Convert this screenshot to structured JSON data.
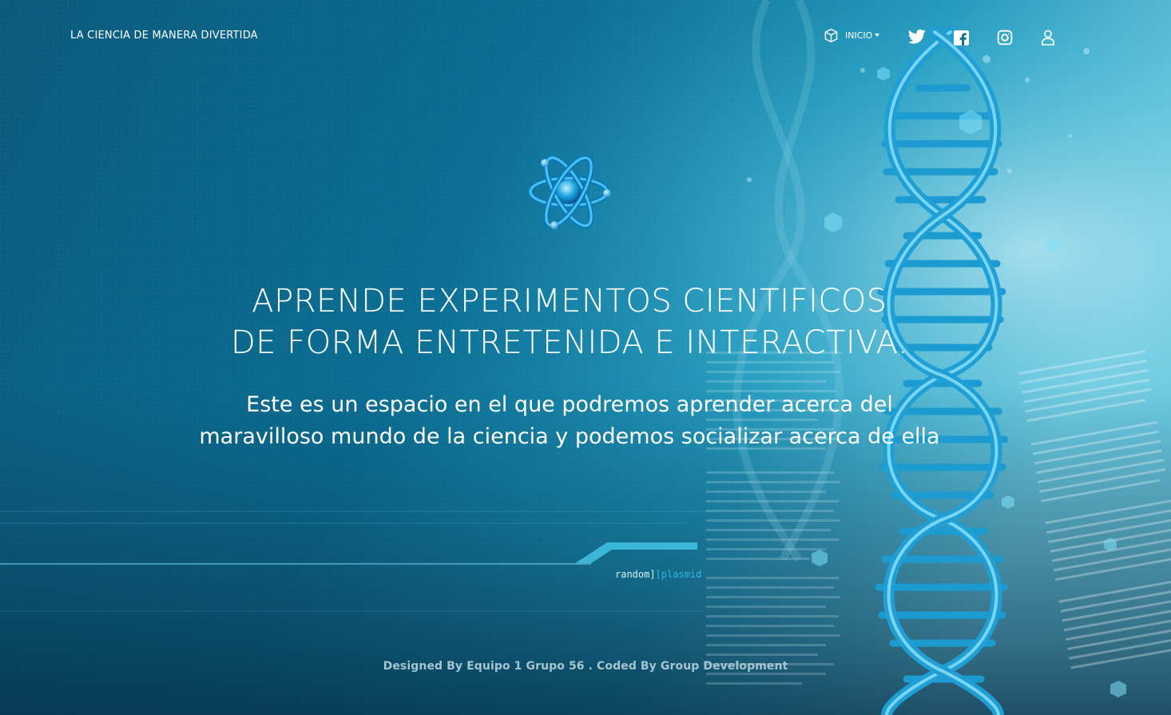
{
  "header": {
    "brand": "LA CIENCIA DE MANERA DIVERTIDA",
    "nav": {
      "inicio_label": "INICIO",
      "icons": [
        "cube-icon",
        "twitter-icon",
        "facebook-icon",
        "instagram-icon",
        "user-icon"
      ]
    }
  },
  "hero": {
    "title_line1": "APRENDE EXPERIMENTOS CIENTIFICOS",
    "title_line2": "DE FORMA ENTRETENIDA E INTERACTIVA.",
    "subtitle": "Este es un espacio en el que podremos aprender acerca del maravilloso mundo de la ciencia y podemos socializar acerca de ella",
    "logo_icon": "atom-icon",
    "decor_text_a": "random]",
    "decor_text_b": "[plasmid"
  },
  "footer": {
    "text": "Designed By Equipo 1 Grupo 56 . Coded By Group Development"
  },
  "colors": {
    "background_dark": "#0a5f80",
    "background_light": "#43bbd8",
    "accent": "#2fb6dc",
    "text": "#ffffff",
    "footer_text": "#a5c5d1"
  }
}
